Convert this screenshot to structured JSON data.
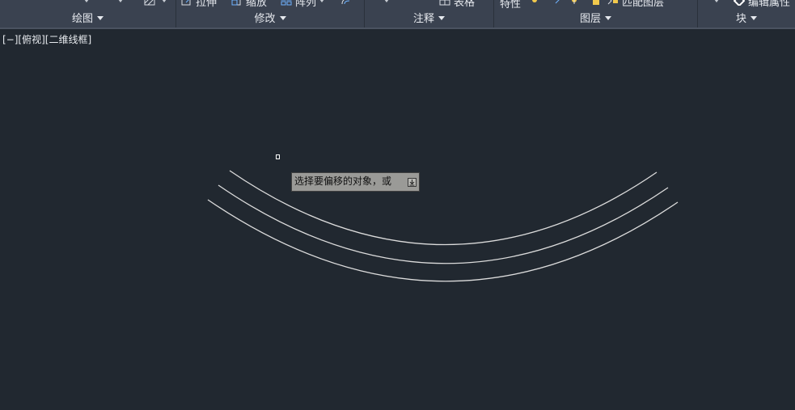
{
  "ribbon": {
    "panels": [
      {
        "title": "绘图"
      },
      {
        "title": "修改"
      },
      {
        "title": "注释"
      },
      {
        "title": "图层"
      },
      {
        "title": "块"
      }
    ],
    "modify_tools": {
      "stretch": "拉伸",
      "scale": "缩放",
      "array": "阵列"
    },
    "annotation_tools": {
      "table": "表格"
    },
    "layer_tools": {
      "properties": "特性",
      "match_layer": "匹配图层"
    },
    "block_tools": {
      "edit_attributes": "编辑属性"
    }
  },
  "viewport": {
    "controls": {
      "minus": "[−]",
      "view": "[俯视]",
      "style": "[二维线框]"
    }
  },
  "command": {
    "tooltip_text": "选择要偏移的对象，或"
  },
  "colors": {
    "canvas": "#212830",
    "ribbon": "#3a4250",
    "arc": "#dcdcdc",
    "tooltip_bg": "#9a9a97"
  }
}
